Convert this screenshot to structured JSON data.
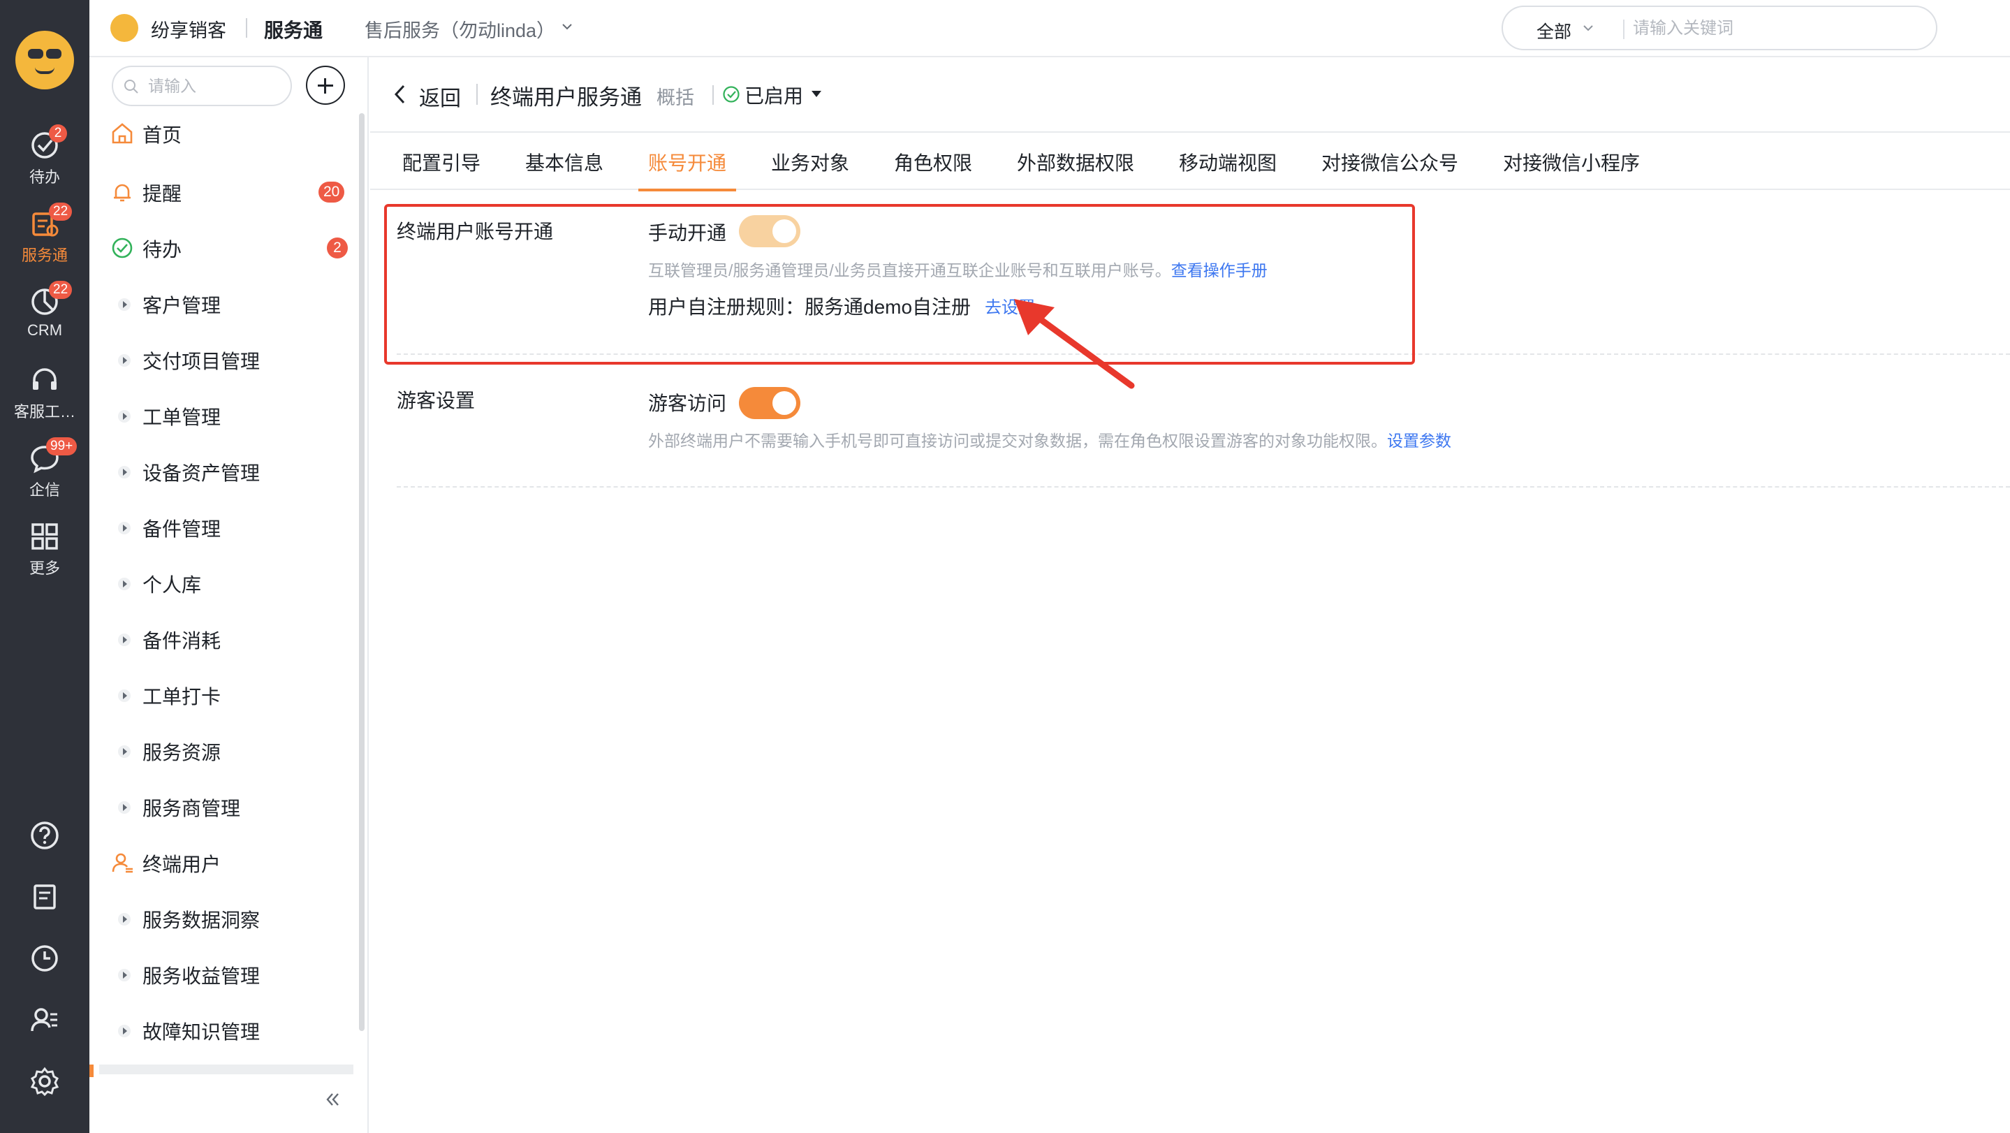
{
  "rail": {
    "items": [
      {
        "label": "待办",
        "badge": "2",
        "icon": "check-circle-icon"
      },
      {
        "label": "服务通",
        "badge": "22",
        "icon": "service-icon"
      },
      {
        "label": "CRM",
        "badge": "22",
        "icon": "pie-chart-icon"
      },
      {
        "label": "客服工…",
        "badge": "",
        "icon": "headset-icon"
      },
      {
        "label": "企信",
        "badge": "99+",
        "icon": "chat-icon"
      },
      {
        "label": "更多",
        "badge": "",
        "icon": "grid-icon"
      }
    ],
    "footer_icons": [
      "help-icon",
      "notebook-icon",
      "clock-icon",
      "user-list-icon",
      "settings-icon"
    ]
  },
  "header": {
    "brand_name": "纷享销客",
    "app_name": "服务通",
    "context": "售后服务（勿动linda）",
    "search_scope": "全部",
    "search_placeholder": "请输入关键词"
  },
  "sidebar": {
    "search_placeholder": "请输入",
    "items": [
      {
        "label": "首页",
        "icon": "home-icon",
        "badge": ""
      },
      {
        "label": "提醒",
        "icon": "bell-icon",
        "badge": "20"
      },
      {
        "label": "待办",
        "icon": "check-circle-icon",
        "badge": "2"
      },
      {
        "label": "客户管理",
        "icon": "caret-right-icon",
        "badge": ""
      },
      {
        "label": "交付项目管理",
        "icon": "caret-right-icon",
        "badge": ""
      },
      {
        "label": "工单管理",
        "icon": "caret-right-icon",
        "badge": ""
      },
      {
        "label": "设备资产管理",
        "icon": "caret-right-icon",
        "badge": ""
      },
      {
        "label": "备件管理",
        "icon": "caret-right-icon",
        "badge": ""
      },
      {
        "label": "个人库",
        "icon": "caret-right-icon",
        "badge": ""
      },
      {
        "label": "备件消耗",
        "icon": "caret-right-icon",
        "badge": ""
      },
      {
        "label": "工单打卡",
        "icon": "caret-right-icon",
        "badge": ""
      },
      {
        "label": "服务资源",
        "icon": "caret-right-icon",
        "badge": ""
      },
      {
        "label": "服务商管理",
        "icon": "caret-right-icon",
        "badge": ""
      },
      {
        "label": "终端用户",
        "icon": "end-user-icon",
        "badge": ""
      },
      {
        "label": "服务数据洞察",
        "icon": "caret-right-icon",
        "badge": ""
      },
      {
        "label": "服务收益管理",
        "icon": "caret-right-icon",
        "badge": ""
      },
      {
        "label": "故障知识管理",
        "icon": "caret-right-icon",
        "badge": ""
      }
    ]
  },
  "titlebar": {
    "back_label": "返回",
    "title": "终端用户服务通",
    "subtitle": "概括",
    "status": "已启用"
  },
  "tabs": [
    {
      "label": "配置引导",
      "active": false
    },
    {
      "label": "基本信息",
      "active": false
    },
    {
      "label": "账号开通",
      "active": true
    },
    {
      "label": "业务对象",
      "active": false
    },
    {
      "label": "角色权限",
      "active": false
    },
    {
      "label": "外部数据权限",
      "active": false
    },
    {
      "label": "移动端视图",
      "active": false
    },
    {
      "label": "对接微信公众号",
      "active": false
    },
    {
      "label": "对接微信小程序",
      "active": false
    }
  ],
  "account_section": {
    "label": "终端用户账号开通",
    "manual_label": "手动开通",
    "manual_enabled": true,
    "manual_desc": "互联管理员/服务通管理员/业务员直接开通互联企业账号和互联用户账号。",
    "manual_link": "查看操作手册",
    "rule_text": "用户自注册规则：服务通demo自注册",
    "rule_link": "去设置"
  },
  "guest_section": {
    "label": "游客设置",
    "guest_label": "游客访问",
    "guest_enabled": true,
    "guest_desc": "外部终端用户不需要输入手机号即可直接访问或提交对象数据，需在角色权限设置游客的对象功能权限。",
    "guest_link": "设置参数"
  },
  "colors": {
    "accent": "#f58a3a",
    "link": "#3d77f0",
    "badge": "#ee5a45",
    "highlight": "#e8382c",
    "rail_bg": "#2e3139"
  }
}
